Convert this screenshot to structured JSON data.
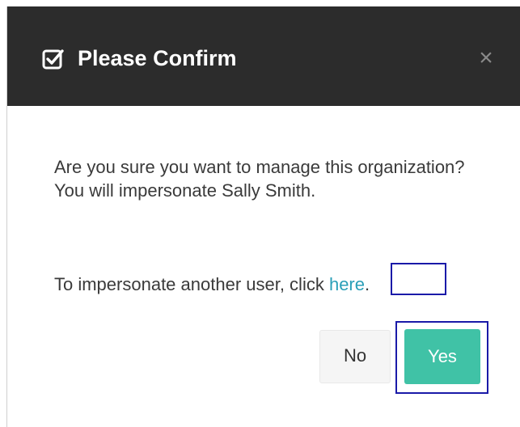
{
  "dialog": {
    "title": "Please Confirm",
    "close_label": "×",
    "header_icon": "check-square-icon",
    "confirm_message": "Are you sure you want to manage this organization? You will impersonate Sally Smith.",
    "alt_message_prefix": "To impersonate another user, click ",
    "alt_message_link": "here",
    "alt_message_suffix": ".",
    "no_label": "No",
    "yes_label": "Yes"
  },
  "colors": {
    "header_bg": "#2c2c2c",
    "accent": "#40c2a6",
    "link": "#2a9fb8",
    "highlight_outline": "#1a1aa8"
  }
}
